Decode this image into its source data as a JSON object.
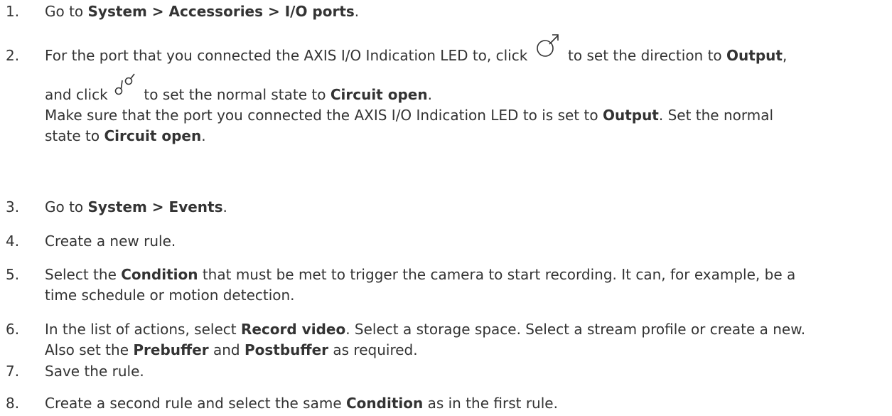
{
  "steps": [
    {
      "number": "1.",
      "parts": [
        "Go to ",
        "System > Accessories > I/O ports",
        "."
      ]
    },
    {
      "number": "2.",
      "line1": [
        "For the port that you connected the AXIS I/O Indication LED to, click ",
        " to set the direction to ",
        "Output",
        ","
      ],
      "line2": [
        "and click ",
        " to set the normal state to ",
        "Circuit open",
        "."
      ],
      "line3": [
        "Make sure that the port you connected the AXIS I/O Indication LED to is set to ",
        "Output",
        ". Set the normal"
      ],
      "line4": [
        "state to ",
        "Circuit open",
        "."
      ],
      "icons": {
        "direction": "output-direction-icon",
        "normal_state": "circuit-open-icon"
      }
    },
    {
      "number": "3.",
      "parts": [
        "Go to ",
        "System > Events",
        "."
      ]
    },
    {
      "number": "4.",
      "parts": [
        "Create a new rule."
      ]
    },
    {
      "number": "5.",
      "line1": [
        "Select the ",
        "Condition",
        " that must be met to trigger the camera to start recording. It can, for example, be a"
      ],
      "line2": [
        "time schedule or motion detection."
      ]
    },
    {
      "number": "6.",
      "line1": [
        "In the list of actions, select ",
        "Record video",
        ". Select a storage space. Select a stream profile or create a new."
      ],
      "line2": [
        "Also set the ",
        "Prebuffer",
        " and ",
        "Postbuffer",
        " as required."
      ]
    },
    {
      "number": "7.",
      "parts": [
        "Save the rule."
      ]
    },
    {
      "number": "8.",
      "parts": [
        "Create a second rule and select the same ",
        "Condition",
        " as in the first rule."
      ]
    }
  ]
}
